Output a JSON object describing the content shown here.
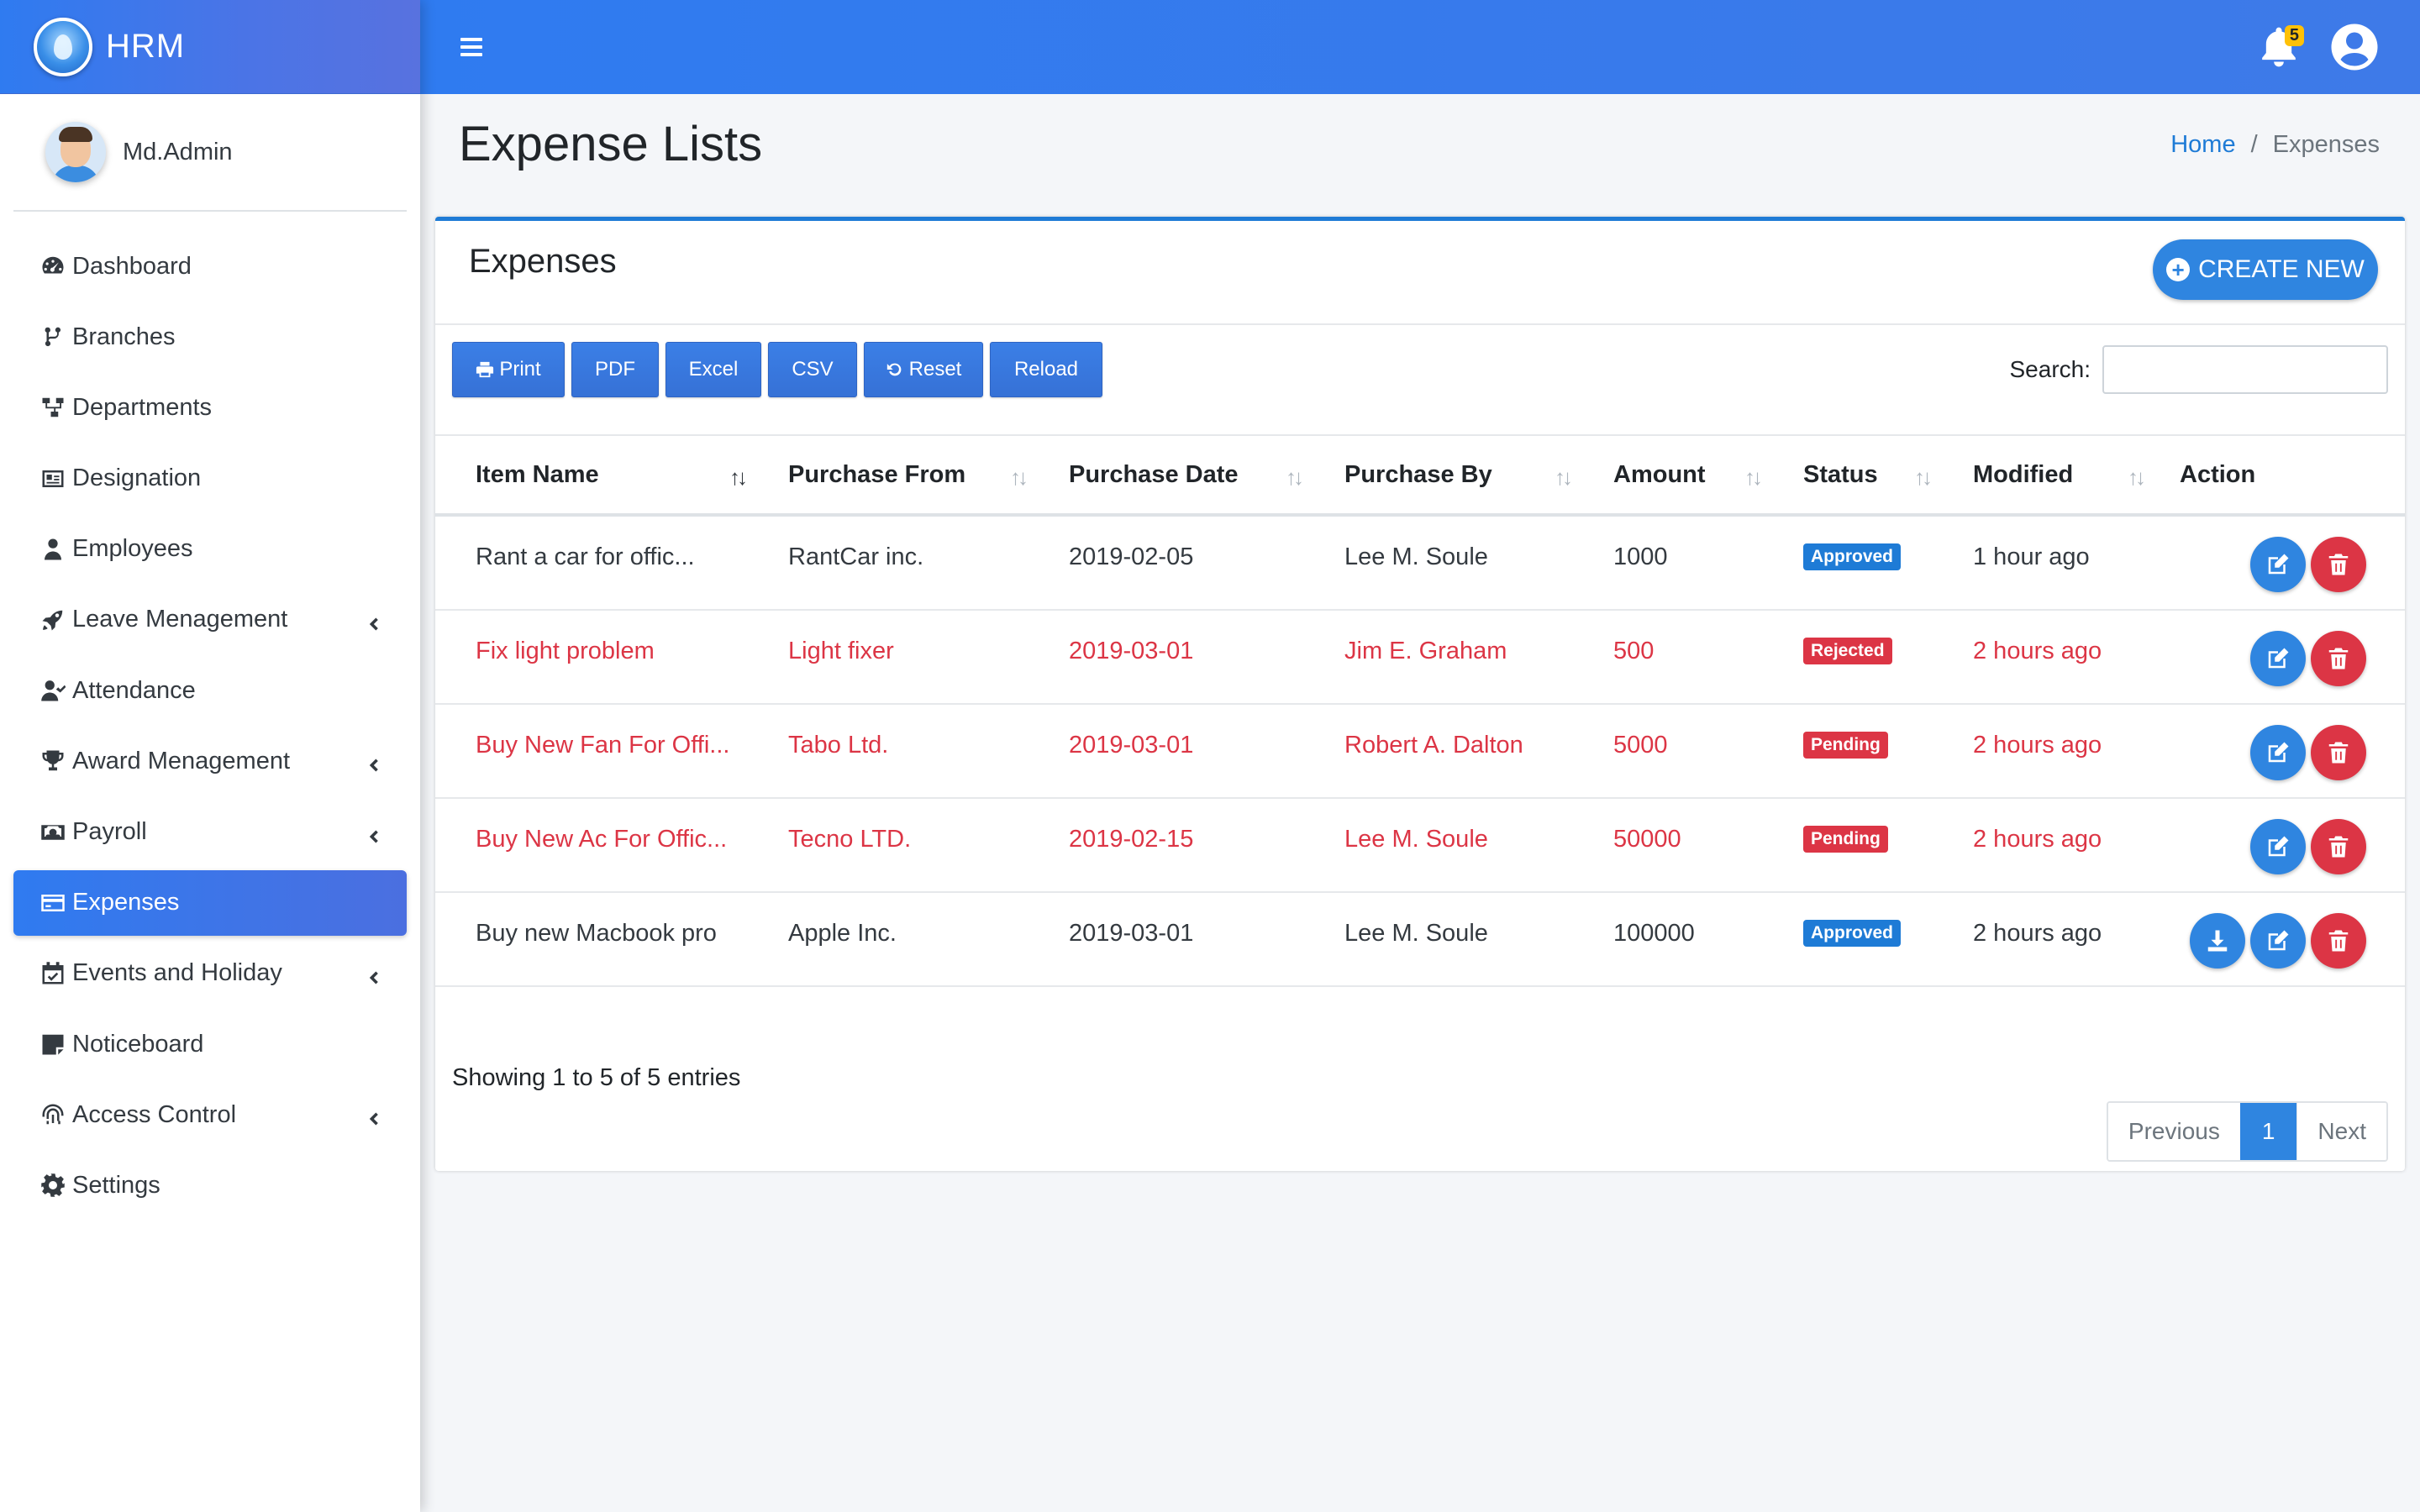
{
  "brand": {
    "name": "HRM"
  },
  "user": {
    "name": "Md.Admin"
  },
  "sidebar": {
    "items": [
      {
        "label": "Dashboard",
        "icon": "dashboard-icon",
        "expandable": false
      },
      {
        "label": "Branches",
        "icon": "branch-icon",
        "expandable": false
      },
      {
        "label": "Departments",
        "icon": "sitemap-icon",
        "expandable": false
      },
      {
        "label": "Designation",
        "icon": "id-card-icon",
        "expandable": false
      },
      {
        "label": "Employees",
        "icon": "user-tie-icon",
        "expandable": false
      },
      {
        "label": "Leave Menagement",
        "icon": "rocket-icon",
        "expandable": true
      },
      {
        "label": "Attendance",
        "icon": "user-check-icon",
        "expandable": false
      },
      {
        "label": "Award Menagement",
        "icon": "trophy-icon",
        "expandable": true
      },
      {
        "label": "Payroll",
        "icon": "money-icon",
        "expandable": true
      },
      {
        "label": "Expenses",
        "icon": "credit-card-icon",
        "expandable": false,
        "active": true
      },
      {
        "label": "Events and Holiday",
        "icon": "calendar-check-icon",
        "expandable": true
      },
      {
        "label": "Noticeboard",
        "icon": "sticky-note-icon",
        "expandable": false
      },
      {
        "label": "Access Control",
        "icon": "fingerprint-icon",
        "expandable": true
      },
      {
        "label": "Settings",
        "icon": "gear-icon",
        "expandable": false
      }
    ]
  },
  "header": {
    "notification_count": "5"
  },
  "page": {
    "title": "Expense Lists",
    "breadcrumb": {
      "home": "Home",
      "separator": "/",
      "current": "Expenses"
    }
  },
  "card": {
    "title": "Expenses",
    "create_label": "CREATE NEW",
    "toolbar": {
      "print": "Print",
      "pdf": "PDF",
      "excel": "Excel",
      "csv": "CSV",
      "reset": "Reset",
      "reload": "Reload"
    },
    "search_label": "Search:",
    "search_value": ""
  },
  "table": {
    "columns": [
      "Item Name",
      "Purchase From",
      "Purchase Date",
      "Purchase By",
      "Amount",
      "Status",
      "Modified",
      "Action"
    ],
    "rows": [
      {
        "item": "Rant a car for offic...",
        "from": "RantCar inc.",
        "date": "2019-02-05",
        "by": "Lee M. Soule",
        "amount": "1000",
        "status": "Approved",
        "modified": "1 hour ago"
      },
      {
        "item": "Fix light problem",
        "from": "Light fixer",
        "date": "2019-03-01",
        "by": "Jim E. Graham",
        "amount": "500",
        "status": "Rejected",
        "modified": "2 hours ago"
      },
      {
        "item": "Buy New Fan For Offi...",
        "from": "Tabo Ltd.",
        "date": "2019-03-01",
        "by": "Robert A. Dalton",
        "amount": "5000",
        "status": "Pending",
        "modified": "2 hours ago"
      },
      {
        "item": "Buy New Ac For Offic...",
        "from": "Tecno LTD.",
        "date": "2019-02-15",
        "by": "Lee M. Soule",
        "amount": "50000",
        "status": "Pending",
        "modified": "2 hours ago"
      },
      {
        "item": "Buy new Macbook pro",
        "from": "Apple Inc.",
        "date": "2019-03-01",
        "by": "Lee M. Soule",
        "amount": "100000",
        "status": "Approved",
        "modified": "2 hours ago"
      }
    ]
  },
  "footer": {
    "showing": "Showing 1 to 5 of 5 entries",
    "previous": "Previous",
    "page": "1",
    "next": "Next"
  },
  "colors": {
    "primary": "#2f7bf0",
    "danger": "#dc3545",
    "link": "#1e7bd6"
  }
}
